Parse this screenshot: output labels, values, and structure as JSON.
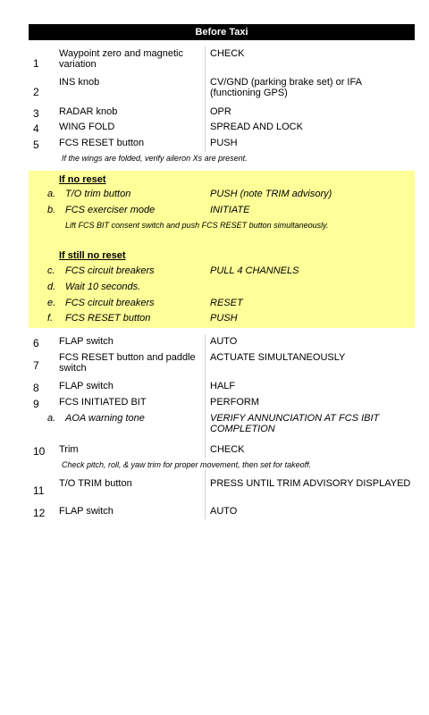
{
  "header": {
    "title": "Before Taxi"
  },
  "rows": [
    {
      "num": "1",
      "item": "Waypoint zero and magnetic variation",
      "action": "CHECK"
    },
    {
      "num": "2",
      "item": "INS knob",
      "action": "CV/GND (parking brake set) or IFA (functioning GPS)"
    },
    {
      "num": "3",
      "item": "RADAR knob",
      "action": "OPR"
    },
    {
      "num": "4",
      "item": "WING FOLD",
      "action": "SPREAD AND LOCK"
    },
    {
      "num": "5",
      "item": "FCS RESET button",
      "action": "PUSH"
    }
  ],
  "note1": "If the wings are folded, verify aileron Xs are present.",
  "block": {
    "heading1": "If no reset",
    "a_letter": "a.",
    "a_item": "T/O trim button",
    "a_action": "PUSH (note TRIM advisory)",
    "b_letter": "b.",
    "b_item": "FCS exerciser mode",
    "b_action": "INITIATE",
    "note2": "Lift FCS BIT consent switch and push FCS RESET button simultaneously.",
    "heading2": "If still no reset",
    "c_letter": "c.",
    "c_item": "FCS circuit breakers",
    "c_action": "PULL 4 CHANNELS",
    "d_letter": "d.",
    "d_item": "Wait 10 seconds.",
    "e_letter": "e.",
    "e_item": "FCS circuit breakers",
    "e_action": "RESET",
    "f_letter": "f.",
    "f_item": "FCS RESET button",
    "f_action": "PUSH"
  },
  "rows2": [
    {
      "num": "6",
      "item": "FLAP switch",
      "action": "AUTO"
    },
    {
      "num": "7",
      "item": "FCS RESET button and paddle switch",
      "action": "ACTUATE SIMULTANEOUSLY"
    },
    {
      "num": "8",
      "item": "FLAP switch",
      "action": "HALF"
    },
    {
      "num": "9",
      "item": "FCS INITIATED BIT",
      "action": "PERFORM"
    }
  ],
  "sub9": {
    "letter": "a.",
    "item": "AOA warning tone",
    "action": "VERIFY ANNUNCIATION AT FCS IBIT COMPLETION"
  },
  "rows3": [
    {
      "num": "10",
      "item": "Trim",
      "action": "CHECK"
    }
  ],
  "note3": "Check pitch, roll, & yaw trim for proper movement, then set for takeoff.",
  "rows4": [
    {
      "num": "11",
      "item": "T/O TRIM button",
      "action": "PRESS UNTIL TRIM ADVISORY DISPLAYED"
    },
    {
      "num": "12",
      "item": "FLAP switch",
      "action": "AUTO"
    }
  ]
}
